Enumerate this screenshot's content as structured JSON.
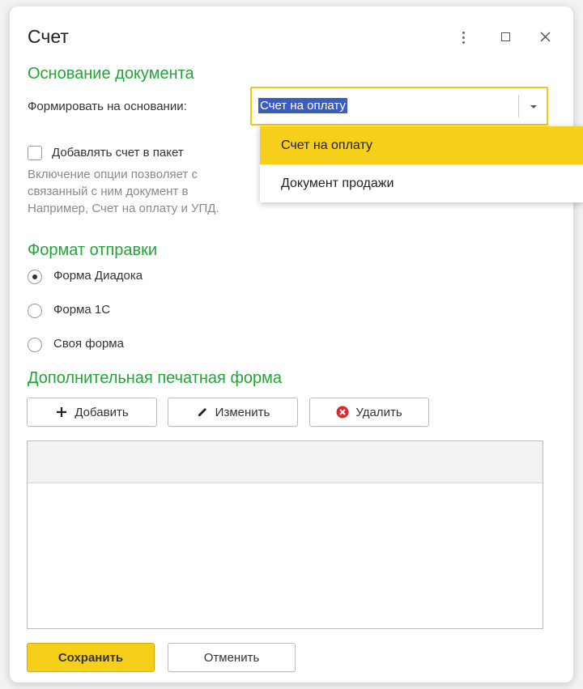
{
  "window": {
    "title": "Счет"
  },
  "section_basis": {
    "title": "Основание документа",
    "field_label": "Формировать на основании:",
    "field_value": "Счет на оплату",
    "checkbox_label": "Добавлять счет в пакет",
    "hint_lines": [
      "Включение опции позволяет с",
      "связанный с ним документ в",
      "Например, Счет на оплату и УПД."
    ]
  },
  "dropdown": {
    "options": [
      "Счет на оплату",
      "Документ продажи"
    ],
    "selected": "Счет на оплату"
  },
  "section_format": {
    "title": "Формат отправки",
    "options": [
      "Форма Диадока",
      "Форма 1С",
      "Своя форма"
    ],
    "selected": "Форма Диадока"
  },
  "section_print": {
    "title": "Дополнительная печатная форма",
    "add_label": "Добавить",
    "edit_label": "Изменить",
    "delete_label": "Удалить"
  },
  "footer": {
    "save_label": "Сохранить",
    "cancel_label": "Отменить"
  },
  "colors": {
    "accent_yellow": "#f5cf1a",
    "section_green": "#21a535",
    "selection_blue": "#3b5ebc",
    "delete_red": "#e0282c"
  }
}
